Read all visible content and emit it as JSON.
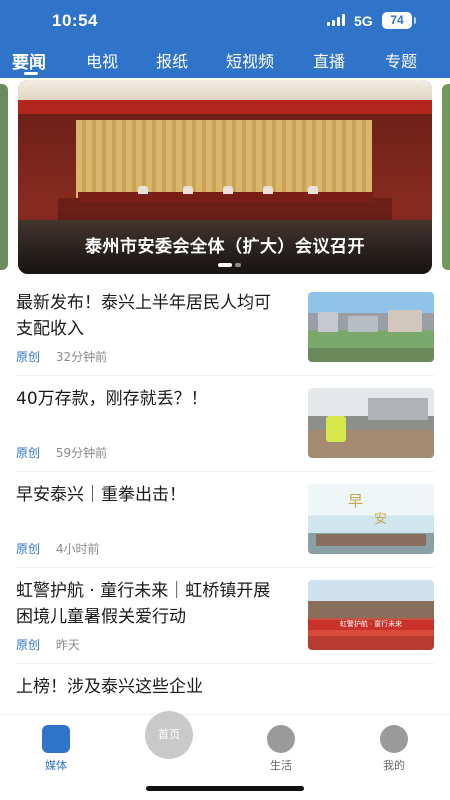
{
  "status": {
    "time": "10:54",
    "network": "5G",
    "battery": "74"
  },
  "tabs": [
    {
      "label": "要闻"
    },
    {
      "label": "电视"
    },
    {
      "label": "报纸"
    },
    {
      "label": "短视频"
    },
    {
      "label": "直播"
    },
    {
      "label": "专题"
    }
  ],
  "carousel": {
    "caption": "泰州市安委会全体（扩大）会议召开"
  },
  "news": [
    {
      "title": "最新发布！泰兴上半年居民人均可支配收入",
      "tag": "原创",
      "time": "32分钟前"
    },
    {
      "title": "40万存款，刚存就丢？！",
      "tag": "原创",
      "time": "59分钟前"
    },
    {
      "title": "早安泰兴｜重拳出击！",
      "tag": "原创",
      "time": "4小时前"
    },
    {
      "title": "虹警护航 · 童行未来｜虹桥镇开展困境儿童暑假关爱行动",
      "tag": "原创",
      "time": "昨天"
    },
    {
      "title": "上榜！涉及泰兴这些企业"
    }
  ],
  "bottom_nav": [
    {
      "label": "媒体"
    },
    {
      "label": "首页"
    },
    {
      "label": "生活"
    },
    {
      "label": "我的"
    }
  ],
  "thumbs": {
    "t3_text_1": "早",
    "t3_text_2": "安",
    "t4_banner": "虹警护航 · 童行未来"
  }
}
